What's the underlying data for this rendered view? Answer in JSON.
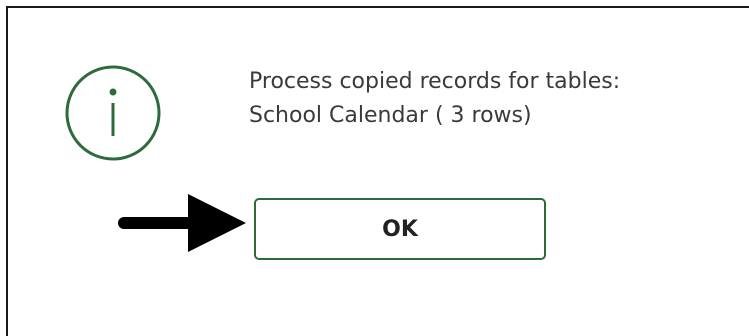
{
  "dialog": {
    "icon": "info-circle-icon",
    "message_lines": [
      "Process copied records for tables:",
      "School Calendar ( 3 rows)"
    ],
    "ok_label": "OK"
  },
  "annotation": {
    "icon": "arrow-right-icon"
  },
  "colors": {
    "accent_green": "#2e6b3a",
    "text": "#3a3a3a",
    "arrow": "#000000"
  }
}
